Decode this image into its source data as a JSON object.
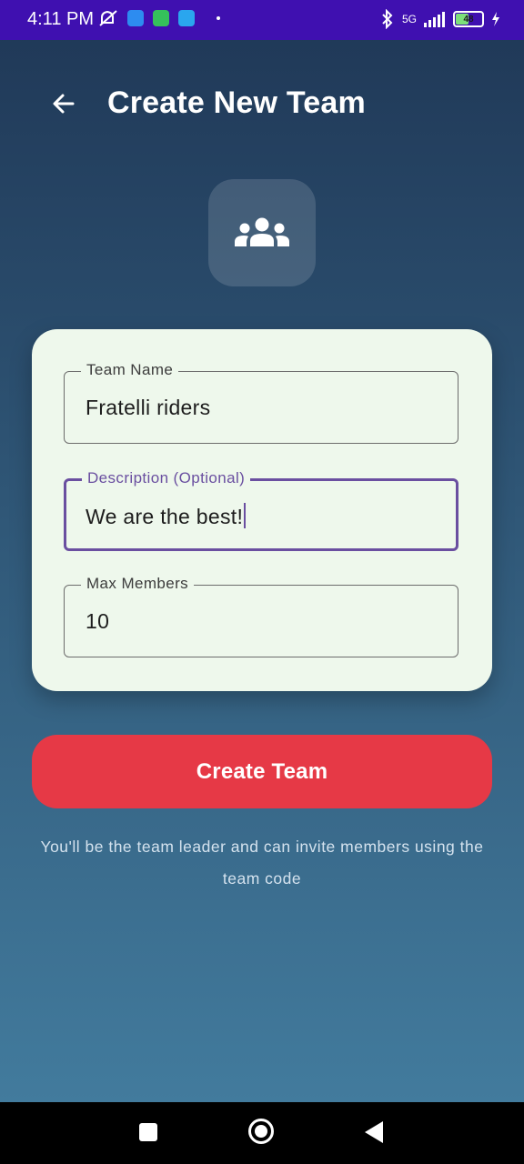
{
  "status_bar": {
    "time": "4:11 PM",
    "network": "5G",
    "battery": "48",
    "icons": [
      "mute-icon",
      "chat-app-icon",
      "wechat-icon",
      "upload-icon",
      "bluetooth-icon",
      "signal-icon",
      "battery-icon",
      "charging-icon"
    ]
  },
  "header": {
    "back_icon": "arrow-left-icon",
    "title": "Create New Team"
  },
  "team_icon": "groups-icon",
  "form": {
    "team_name": {
      "label": "Team Name",
      "value": "Fratelli riders"
    },
    "description": {
      "label": "Description (Optional)",
      "value": "We are the best!"
    },
    "max_members": {
      "label": "Max Members",
      "value": "10"
    }
  },
  "create_button": {
    "label": "Create Team"
  },
  "hint_text": "You'll be the team leader and can invite members using the team code",
  "colors": {
    "status_bar": "#3f10b0",
    "card_bg": "#eef8ec",
    "focus_border": "#6a4fa0",
    "primary_button": "#e63946"
  }
}
